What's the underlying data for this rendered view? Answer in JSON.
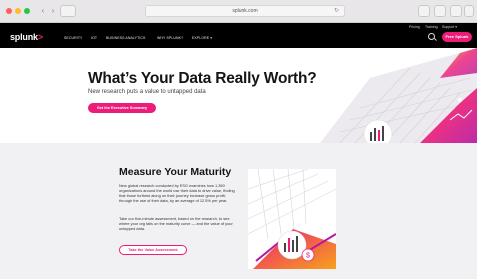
{
  "browser": {
    "url": "splunk.com",
    "reload_icon": "reload-icon"
  },
  "header": {
    "logo_text": "splunk",
    "logo_chevron": ">",
    "utility_links": [
      "Pricing",
      "Training",
      "Support ▾"
    ],
    "nav_items": [
      "Security",
      "IoT",
      "Business Analytics",
      "Why Splunk?",
      "Explore ▾"
    ],
    "free_button": "Free Splunk",
    "accent_color": "#ec1c78"
  },
  "hero": {
    "title": "What’s Your Data Really Worth?",
    "subtitle": "New research puts a value to untapped data",
    "cta": "Get the Executive Summary"
  },
  "section": {
    "title": "Measure Your Maturity",
    "paragraph1": "New global research conducted by ESG examines how 1,350 organizations around the world use their data to drive value, finding that those furthest along on their journey increase gross profit, through the use of their data, by an average of 12.5% per year.",
    "paragraph2": "Take our five-minute assessment, based on the research, to see where your org falls on the maturity curve — and the value of your untapped data.",
    "cta": "Take the Value Assessment"
  }
}
